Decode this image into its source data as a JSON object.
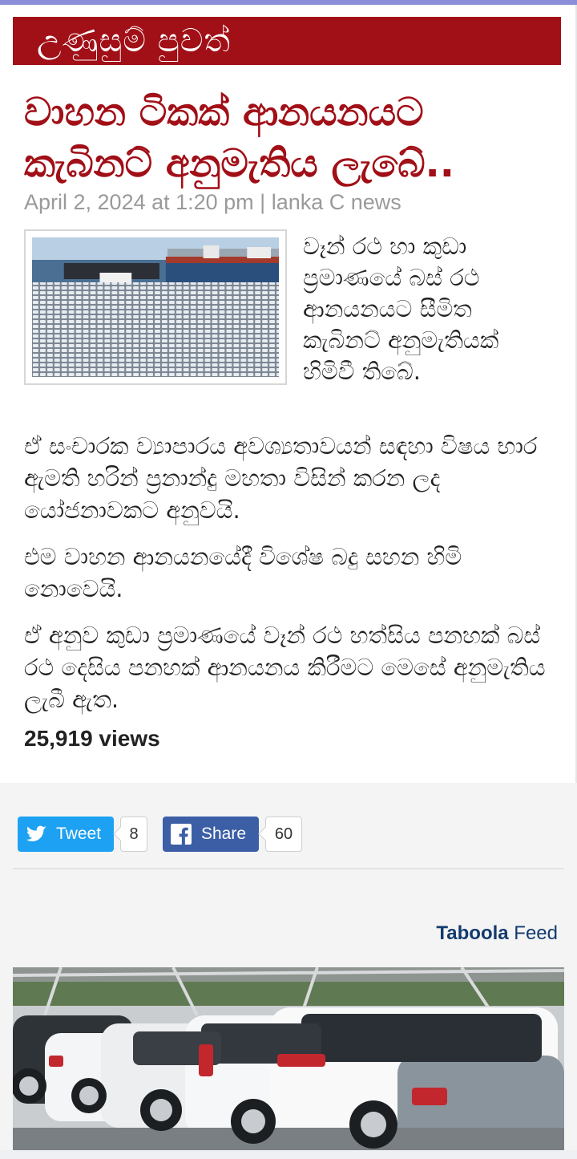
{
  "category": "උණුසුම් පුවත්",
  "headline": "වාහන ටිකක් ආනයනයට කැබිනට් අනුමැතිය ලැබේ..",
  "meta": "April 2, 2024 at 1:20 pm | lanka C news",
  "lead": "වෑන් රථ හා කුඩා ප්‍රමාණයේ බස් රථ ආනයනයට සීමිත කැබිනට් අනුමැතියක් හිමිවී තිබේ.",
  "paragraphs": [
    "ඒ සංචාරක ව්‍යාපාරය අවශ්‍යතාවයන් සඳහා විෂය භාර ඇමති හරින් ප්‍රනාන්දු මහතා විසින් කරන ලද යෝජනාවකට අනුවයි.",
    "එම වාහන ආනයනයේදී විශේෂ බදු සහන හිමි නොවෙයි.",
    "ඒ අනුව කුඩා ප්‍රමාණයේ වෑන් රථ හත්සිය පනහක් බස් රථ දෙසිය පනහක් ආනයනය කිරීමට මෙසේ අනුමැතිය ලැබී ඇත."
  ],
  "views": "25,919 views",
  "share": {
    "tweet_label": "Tweet",
    "tweet_count": "8",
    "share_label": "Share",
    "share_count": "60"
  },
  "taboola": {
    "brand": "Taboola",
    "feed": "Feed"
  },
  "colors": {
    "brand_red": "#a10f17",
    "twitter": "#1da1f2",
    "facebook": "#3b5ea5"
  }
}
